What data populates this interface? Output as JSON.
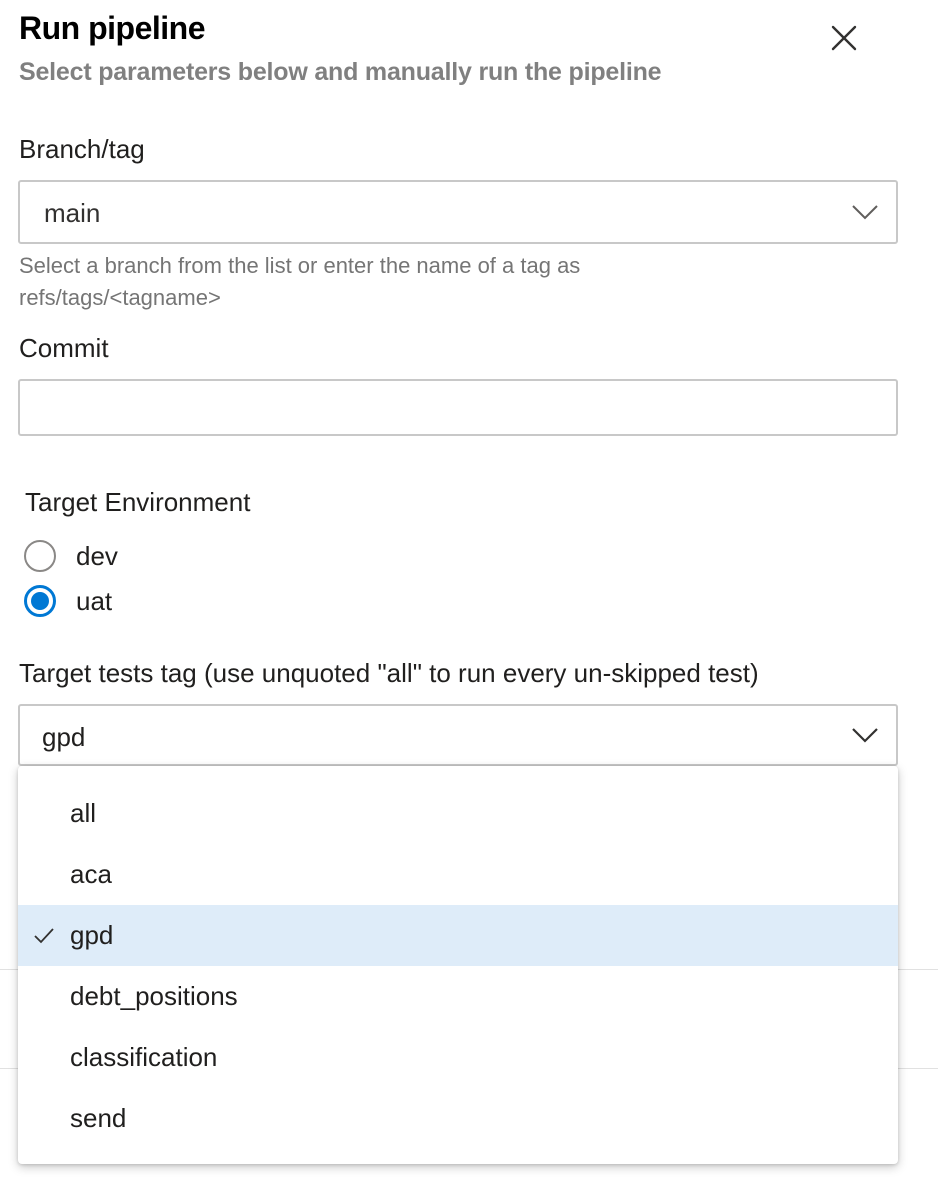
{
  "header": {
    "title": "Run pipeline",
    "subtitle": "Select parameters below and manually run the pipeline"
  },
  "icons": {
    "close": "close-icon",
    "chevron": "chevron-down-icon",
    "check": "checkmark-icon"
  },
  "branch": {
    "label": "Branch/tag",
    "value": "main",
    "helper_line1": "Select a branch from the list or enter the name of a tag as",
    "helper_line2": "refs/tags/<tagname>"
  },
  "commit": {
    "label": "Commit",
    "value": ""
  },
  "environment": {
    "label": "Target Environment",
    "options": [
      {
        "label": "dev",
        "checked": false
      },
      {
        "label": "uat",
        "checked": true
      }
    ]
  },
  "tests_tag": {
    "label": "Target tests tag (use unquoted \"all\" to run every un-skipped test)",
    "value": "gpd",
    "options": [
      {
        "label": "all",
        "selected": false
      },
      {
        "label": "aca",
        "selected": false
      },
      {
        "label": "gpd",
        "selected": true
      },
      {
        "label": "debt_positions",
        "selected": false
      },
      {
        "label": "classification",
        "selected": false
      },
      {
        "label": "send",
        "selected": false
      }
    ]
  },
  "colors": {
    "accent": "#0078d4",
    "selected_bg": "#deecf9",
    "subtitle": "#808080",
    "helper": "#757575"
  }
}
